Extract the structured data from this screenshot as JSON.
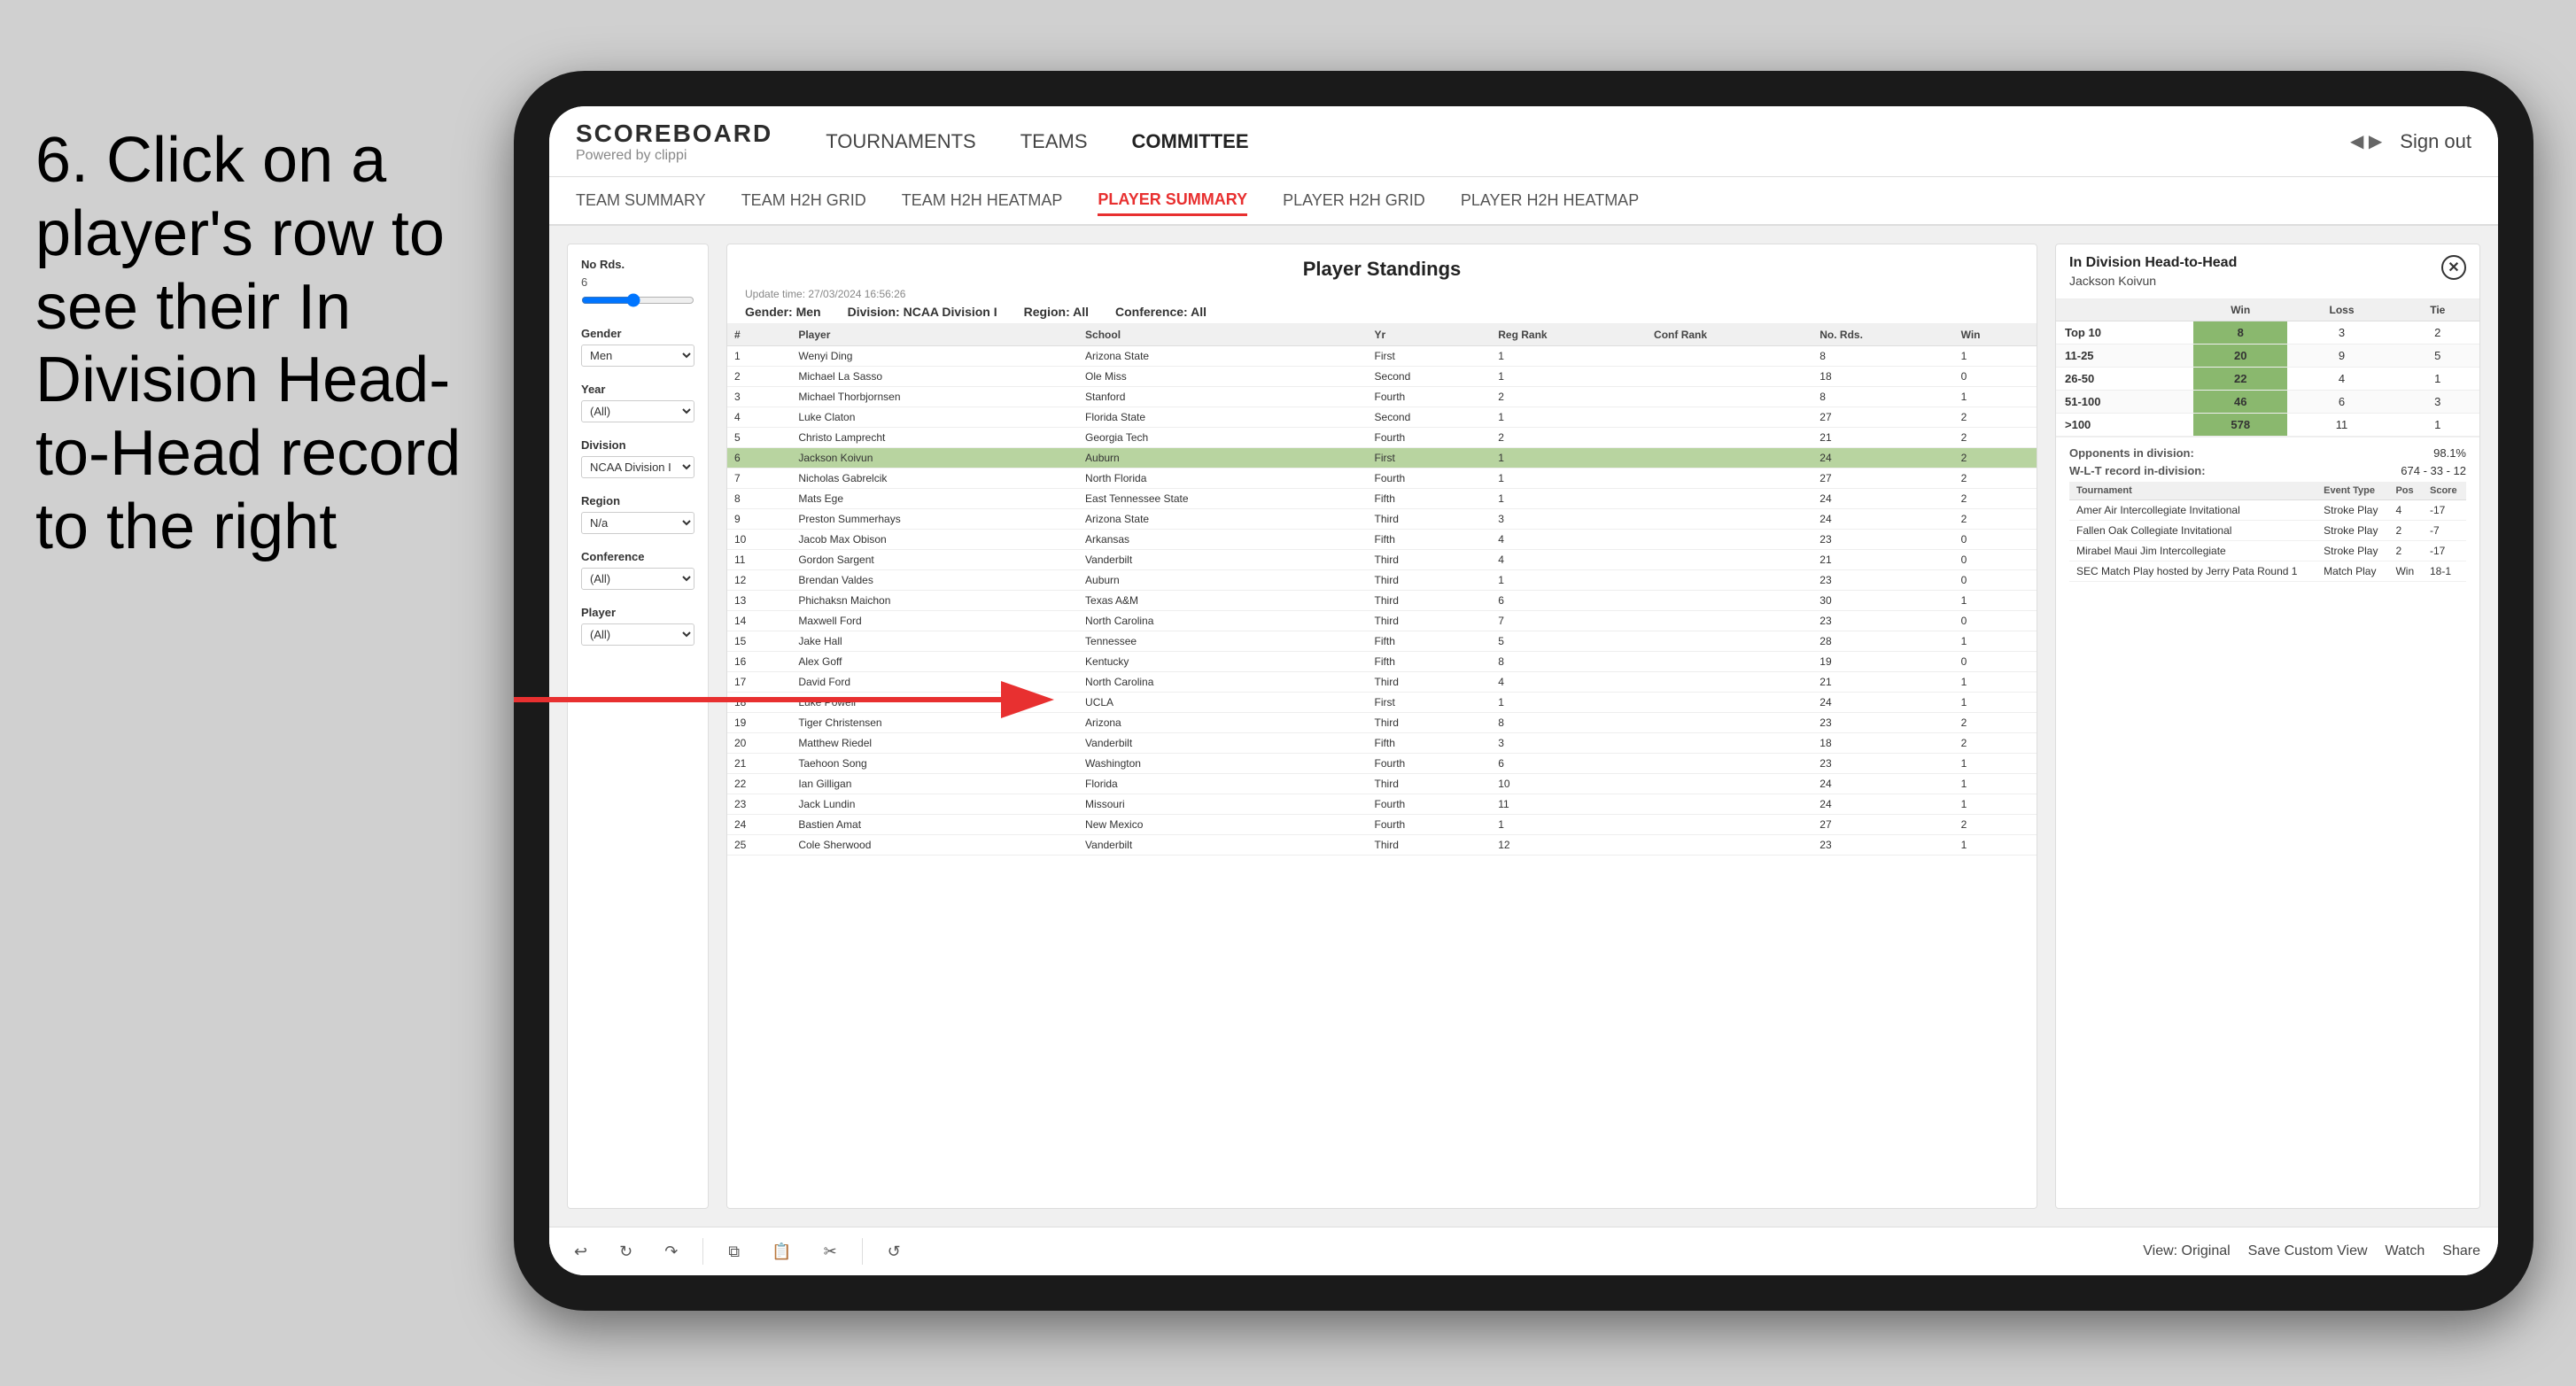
{
  "instruction": {
    "text": "6. Click on a player's row to see their In Division Head-to-Head record to the right"
  },
  "navbar": {
    "logo": "SCOREBOARD",
    "logo_sub": "Powered by clippi",
    "links": [
      "TOURNAMENTS",
      "TEAMS",
      "COMMITTEE"
    ],
    "sign_out": "Sign out"
  },
  "subnav": {
    "links": [
      "TEAM SUMMARY",
      "TEAM H2H GRID",
      "TEAM H2H HEATMAP",
      "PLAYER SUMMARY",
      "PLAYER H2H GRID",
      "PLAYER H2H HEATMAP"
    ],
    "active": "PLAYER SUMMARY"
  },
  "filter_panel": {
    "no_rds_label": "No Rds.",
    "no_rds_value": "6",
    "gender_label": "Gender",
    "gender_value": "Men",
    "year_label": "Year",
    "year_value": "(All)",
    "division_label": "Division",
    "division_value": "NCAA Division I",
    "region_label": "Region",
    "region_value": "N/a",
    "conference_label": "Conference",
    "conference_value": "(All)",
    "player_label": "Player",
    "player_value": "(All)"
  },
  "standings": {
    "title": "Player Standings",
    "update_time": "Update time: 27/03/2024 16:56:26",
    "gender": "Men",
    "division": "NCAA Division I",
    "region": "All",
    "conference": "All",
    "columns": [
      "#",
      "Player",
      "School",
      "Yr",
      "Reg Rank",
      "Conf Rank",
      "No. Rds.",
      "Win"
    ],
    "rows": [
      {
        "rank": 1,
        "player": "Wenyi Ding",
        "school": "Arizona State",
        "yr": "First",
        "reg_rank": 1,
        "conf_rank": "",
        "no_rds": 8,
        "win": 1
      },
      {
        "rank": 2,
        "player": "Michael La Sasso",
        "school": "Ole Miss",
        "yr": "Second",
        "reg_rank": 1,
        "conf_rank": "",
        "no_rds": 18,
        "win": 0
      },
      {
        "rank": 3,
        "player": "Michael Thorbjornsen",
        "school": "Stanford",
        "yr": "Fourth",
        "reg_rank": 2,
        "conf_rank": "",
        "no_rds": 8,
        "win": 1
      },
      {
        "rank": 4,
        "player": "Luke Claton",
        "school": "Florida State",
        "yr": "Second",
        "reg_rank": 1,
        "conf_rank": "",
        "no_rds": 27,
        "win": 2
      },
      {
        "rank": 5,
        "player": "Christo Lamprecht",
        "school": "Georgia Tech",
        "yr": "Fourth",
        "reg_rank": 2,
        "conf_rank": "",
        "no_rds": 21,
        "win": 2
      },
      {
        "rank": 6,
        "player": "Jackson Koivun",
        "school": "Auburn",
        "yr": "First",
        "reg_rank": 1,
        "conf_rank": "",
        "no_rds": 24,
        "win": 2,
        "selected": true
      },
      {
        "rank": 7,
        "player": "Nicholas Gabrelcik",
        "school": "North Florida",
        "yr": "Fourth",
        "reg_rank": 1,
        "conf_rank": "",
        "no_rds": 27,
        "win": 2
      },
      {
        "rank": 8,
        "player": "Mats Ege",
        "school": "East Tennessee State",
        "yr": "Fifth",
        "reg_rank": 1,
        "conf_rank": "",
        "no_rds": 24,
        "win": 2
      },
      {
        "rank": 9,
        "player": "Preston Summerhays",
        "school": "Arizona State",
        "yr": "Third",
        "reg_rank": 3,
        "conf_rank": "",
        "no_rds": 24,
        "win": 2
      },
      {
        "rank": 10,
        "player": "Jacob Max Obison",
        "school": "Arkansas",
        "yr": "Fifth",
        "reg_rank": 4,
        "conf_rank": "",
        "no_rds": 23,
        "win": 0
      },
      {
        "rank": 11,
        "player": "Gordon Sargent",
        "school": "Vanderbilt",
        "yr": "Third",
        "reg_rank": 4,
        "conf_rank": "",
        "no_rds": 21,
        "win": 0
      },
      {
        "rank": 12,
        "player": "Brendan Valdes",
        "school": "Auburn",
        "yr": "Third",
        "reg_rank": 1,
        "conf_rank": "",
        "no_rds": 23,
        "win": 0
      },
      {
        "rank": 13,
        "player": "Phichaksn Maichon",
        "school": "Texas A&M",
        "yr": "Third",
        "reg_rank": 6,
        "conf_rank": "",
        "no_rds": 30,
        "win": 1
      },
      {
        "rank": 14,
        "player": "Maxwell Ford",
        "school": "North Carolina",
        "yr": "Third",
        "reg_rank": 7,
        "conf_rank": "",
        "no_rds": 23,
        "win": 0
      },
      {
        "rank": 15,
        "player": "Jake Hall",
        "school": "Tennessee",
        "yr": "Fifth",
        "reg_rank": 5,
        "conf_rank": "",
        "no_rds": 28,
        "win": 1
      },
      {
        "rank": 16,
        "player": "Alex Goff",
        "school": "Kentucky",
        "yr": "Fifth",
        "reg_rank": 8,
        "conf_rank": "",
        "no_rds": 19,
        "win": 0
      },
      {
        "rank": 17,
        "player": "David Ford",
        "school": "North Carolina",
        "yr": "Third",
        "reg_rank": 4,
        "conf_rank": "",
        "no_rds": 21,
        "win": 1
      },
      {
        "rank": 18,
        "player": "Luke Powell",
        "school": "UCLA",
        "yr": "First",
        "reg_rank": 1,
        "conf_rank": "",
        "no_rds": 24,
        "win": 1
      },
      {
        "rank": 19,
        "player": "Tiger Christensen",
        "school": "Arizona",
        "yr": "Third",
        "reg_rank": 8,
        "conf_rank": "",
        "no_rds": 23,
        "win": 2
      },
      {
        "rank": 20,
        "player": "Matthew Riedel",
        "school": "Vanderbilt",
        "yr": "Fifth",
        "reg_rank": 3,
        "conf_rank": "",
        "no_rds": 18,
        "win": 2
      },
      {
        "rank": 21,
        "player": "Taehoon Song",
        "school": "Washington",
        "yr": "Fourth",
        "reg_rank": 6,
        "conf_rank": "",
        "no_rds": 23,
        "win": 1
      },
      {
        "rank": 22,
        "player": "Ian Gilligan",
        "school": "Florida",
        "yr": "Third",
        "reg_rank": 10,
        "conf_rank": "",
        "no_rds": 24,
        "win": 1
      },
      {
        "rank": 23,
        "player": "Jack Lundin",
        "school": "Missouri",
        "yr": "Fourth",
        "reg_rank": 11,
        "conf_rank": "",
        "no_rds": 24,
        "win": 1
      },
      {
        "rank": 24,
        "player": "Bastien Amat",
        "school": "New Mexico",
        "yr": "Fourth",
        "reg_rank": 1,
        "conf_rank": "",
        "no_rds": 27,
        "win": 2
      },
      {
        "rank": 25,
        "player": "Cole Sherwood",
        "school": "Vanderbilt",
        "yr": "Third",
        "reg_rank": 12,
        "conf_rank": "",
        "no_rds": 23,
        "win": 1
      }
    ]
  },
  "h2h": {
    "title": "In Division Head-to-Head",
    "player": "Jackson Koivun",
    "table": {
      "headers": [
        "",
        "Win",
        "Loss",
        "Tie"
      ],
      "rows": [
        {
          "cat": "Top 10",
          "win": 8,
          "loss": 3,
          "tie": 2
        },
        {
          "cat": "11-25",
          "win": 20,
          "loss": 9,
          "tie": 5
        },
        {
          "cat": "26-50",
          "win": 22,
          "loss": 4,
          "tie": 1
        },
        {
          "cat": "51-100",
          "win": 46,
          "loss": 6,
          "tie": 3
        },
        {
          "cat": ">100",
          "win": 578,
          "loss": 11,
          "tie": 1
        }
      ]
    },
    "opponents_label": "Opponents in division:",
    "opponents_value": "98.1%",
    "wl_label": "W-L-T record in-division:",
    "wl_value": "674 - 33 - 12",
    "tournament_columns": [
      "Tournament",
      "Event Type",
      "Pos",
      "Score"
    ],
    "tournaments": [
      {
        "name": "Amer Air Intercollegiate Invitational",
        "type": "Stroke Play",
        "pos": 4,
        "score": "-17"
      },
      {
        "name": "Fallen Oak Collegiate Invitational",
        "type": "Stroke Play",
        "pos": 2,
        "score": "-7"
      },
      {
        "name": "Mirabel Maui Jim Intercollegiate",
        "type": "Stroke Play",
        "pos": 2,
        "score": "-17"
      },
      {
        "name": "SEC Match Play hosted by Jerry Pata Round 1",
        "type": "Match Play",
        "pos": "Win",
        "score": "18-1"
      }
    ]
  },
  "toolbar": {
    "view_original": "View: Original",
    "save_custom": "Save Custom View",
    "watch": "Watch",
    "share": "Share"
  }
}
